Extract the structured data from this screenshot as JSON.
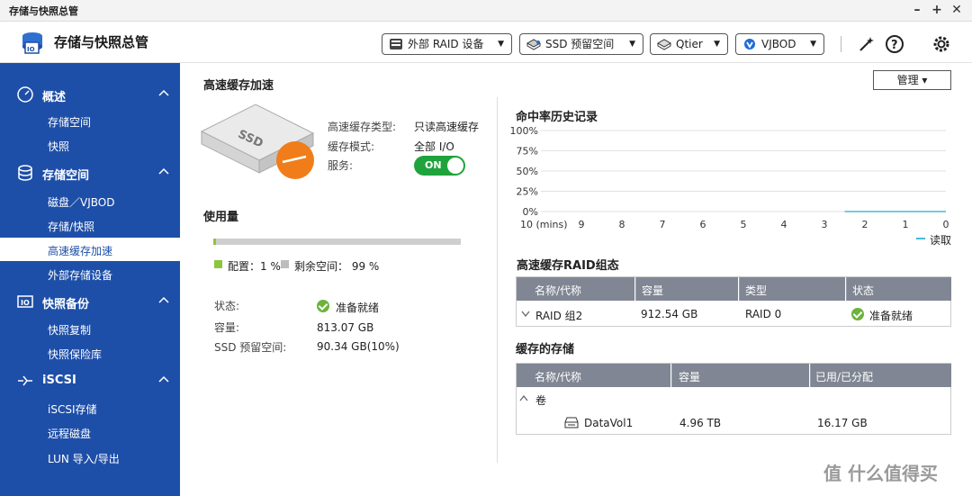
{
  "window": {
    "title": "存储与快照总管"
  },
  "header": {
    "app_title": "存储与快照总管",
    "buttons": [
      {
        "label": "外部 RAID 设备"
      },
      {
        "label": "SSD 预留空间"
      },
      {
        "label": "Qtier"
      },
      {
        "label": "VJBOD"
      }
    ]
  },
  "sidebar": {
    "sections": [
      {
        "label": "概述",
        "items": [
          "存储空间",
          "快照"
        ]
      },
      {
        "label": "存储空间",
        "items": [
          "磁盘／VJBOD",
          "存储/快照",
          "高速缓存加速",
          "外部存储设备"
        ]
      },
      {
        "label": "快照备份",
        "items": [
          "快照复制",
          "快照保险库"
        ]
      },
      {
        "label": "iSCSI",
        "items": [
          "iSCSI存储",
          "远程磁盘",
          "LUN 导入/导出"
        ]
      }
    ],
    "active": "高速缓存加速"
  },
  "cache": {
    "title": "高速缓存加速",
    "ssd_label": "SSD",
    "type_label": "高速缓存类型:",
    "type_value": "只读高速缓存",
    "mode_label": "缓存模式:",
    "mode_value": "全部 I/O",
    "service_label": "服务:",
    "service_value": "ON"
  },
  "usage": {
    "title": "使用量",
    "allocated_pct": 1,
    "allocated_text": "配置：1 %",
    "free_text": "剩余空间： 99 %",
    "status_label": "状态:",
    "status_value": "准备就绪",
    "capacity_label": "容量:",
    "capacity_value": "813.07 GB",
    "reserved_label": "SSD 预留空间:",
    "reserved_value": "90.34 GB(10%)"
  },
  "manage_button": "管理",
  "hit_history": {
    "title": "命中率历史记录"
  },
  "chart_data": {
    "type": "line",
    "title": "命中率历史记录",
    "y_ticks": [
      "100%",
      "75%",
      "50%",
      "25%",
      "0%"
    ],
    "x_ticks": [
      "10 (mins)",
      "9",
      "8",
      "7",
      "6",
      "5",
      "4",
      "3",
      "2",
      "1",
      "0"
    ],
    "ylim": [
      0,
      100
    ],
    "series": [
      {
        "name": "读取",
        "x": [
          2.5,
          0
        ],
        "values": [
          0,
          0
        ],
        "color": "#4ab8d8"
      }
    ],
    "legend": "bottom-right"
  },
  "raid_group": {
    "title": "高速缓存RAID组态",
    "headers": [
      "名称/代称",
      "容量",
      "类型",
      "状态"
    ],
    "rows": [
      {
        "name": "RAID 组2",
        "capacity": "912.54 GB",
        "type": "RAID 0",
        "status": "准备就绪"
      }
    ]
  },
  "cached_storage": {
    "title": "缓存的存储",
    "headers": [
      "名称/代称",
      "容量",
      "已用/已分配"
    ],
    "group": "卷",
    "rows": [
      {
        "name": "DataVol1",
        "capacity": "4.96 TB",
        "used": "16.17 GB"
      }
    ]
  },
  "watermark": "值 什么值得买"
}
